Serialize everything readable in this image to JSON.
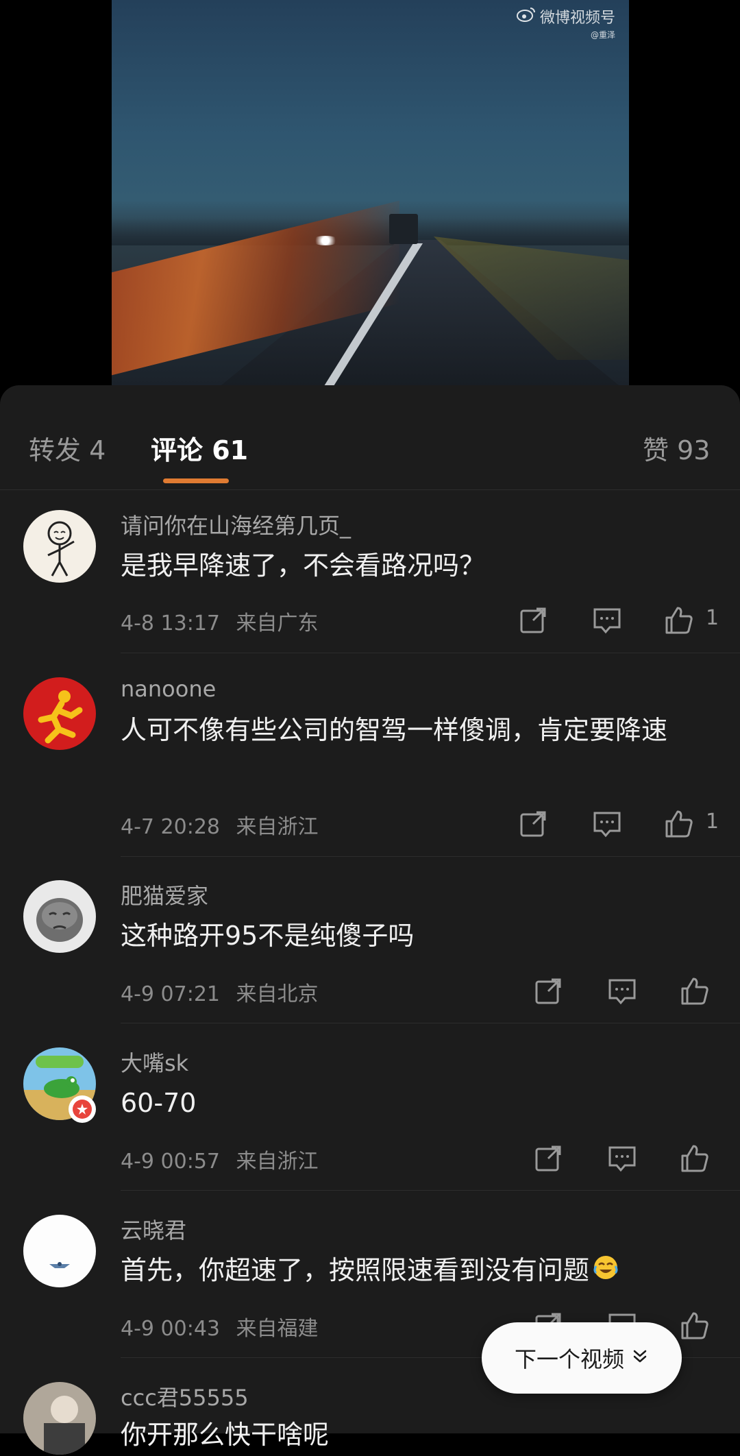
{
  "video": {
    "watermark_brand": "微博视频号",
    "watermark_sub": "@重泽"
  },
  "tabs": {
    "repost": "转发 4",
    "comments": "评论 61",
    "likes": "赞 93"
  },
  "comments": [
    {
      "name": "请问你在山海经第几页_",
      "text": "是我早降速了，不会看路况吗？",
      "time": "4-8 13:17",
      "location": "来自广东",
      "likes": "1"
    },
    {
      "name": "nanoone",
      "text": "人可不像有些公司的智驾一样傻调，肯定要降速",
      "time": "4-7 20:28",
      "location": "来自浙江",
      "likes": "1"
    },
    {
      "name": "肥猫爱家",
      "text": "这种路开95不是纯傻子吗",
      "time": "4-9 07:21",
      "location": "来自北京",
      "likes": ""
    },
    {
      "name": "大嘴sk",
      "text": "60-70",
      "time": "4-9 00:57",
      "location": "来自浙江",
      "likes": ""
    },
    {
      "name": "云晓君",
      "text": "首先，你超速了，按照限速看到没有问题",
      "time": "4-9 00:43",
      "location": "来自福建",
      "likes": ""
    },
    {
      "name": "ccc君55555",
      "text": "你开那么快干啥呢",
      "time": "",
      "location": "",
      "likes": ""
    }
  ],
  "next_video": {
    "label": "下一个视频"
  },
  "colors": {
    "accent": "#e07b32",
    "panel_bg": "#1c1c1c"
  }
}
